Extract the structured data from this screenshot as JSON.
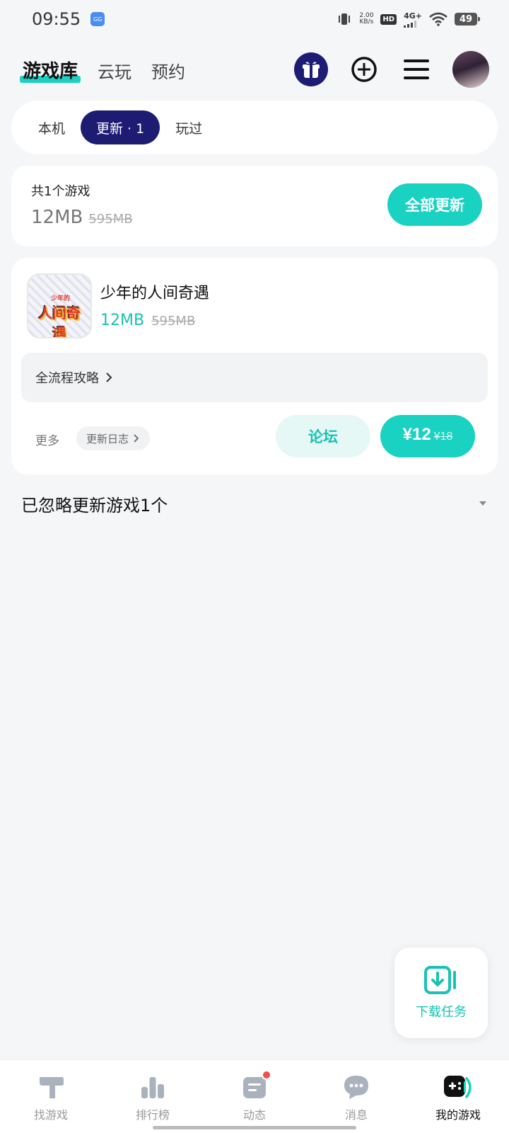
{
  "status_bar": {
    "time": "09:55",
    "app_icon_text": "GG",
    "net_speed_value": "2.00",
    "net_speed_unit": "KB/s",
    "hd_label": "HD",
    "signal_label": "4G+",
    "battery": "49"
  },
  "top_nav": {
    "tabs": [
      {
        "label": "游戏库",
        "active": true
      },
      {
        "label": "云玩",
        "active": false
      },
      {
        "label": "预约",
        "active": false
      }
    ]
  },
  "segments": [
    {
      "label": "本机",
      "active": false
    },
    {
      "label": "更新 · 1",
      "active": true
    },
    {
      "label": "玩过",
      "active": false
    }
  ],
  "summary": {
    "title": "共1个游戏",
    "size_new": "12MB",
    "size_old": "595MB",
    "update_all_label": "全部更新"
  },
  "game": {
    "name": "少年的人间奇遇",
    "icon_badge": "少年的",
    "icon_logo_text": "人间奇遇",
    "size_new": "12MB",
    "size_old": "595MB",
    "guide_label": "全流程攻略",
    "more_label": "更多",
    "changelog_label": "更新日志",
    "forum_label": "论坛",
    "price_now": "¥12",
    "price_old": "¥18"
  },
  "ignored": {
    "label": "已忽略更新游戏1个"
  },
  "download_fab": {
    "label": "下载任务"
  },
  "bottom_nav": [
    {
      "label": "找游戏",
      "active": false
    },
    {
      "label": "排行榜",
      "active": false
    },
    {
      "label": "动态",
      "active": false,
      "badge": true
    },
    {
      "label": "消息",
      "active": false
    },
    {
      "label": "我的游戏",
      "active": true
    }
  ],
  "colors": {
    "accent": "#19d2c1",
    "navy": "#1e1b73",
    "background": "#f5f6f8"
  }
}
